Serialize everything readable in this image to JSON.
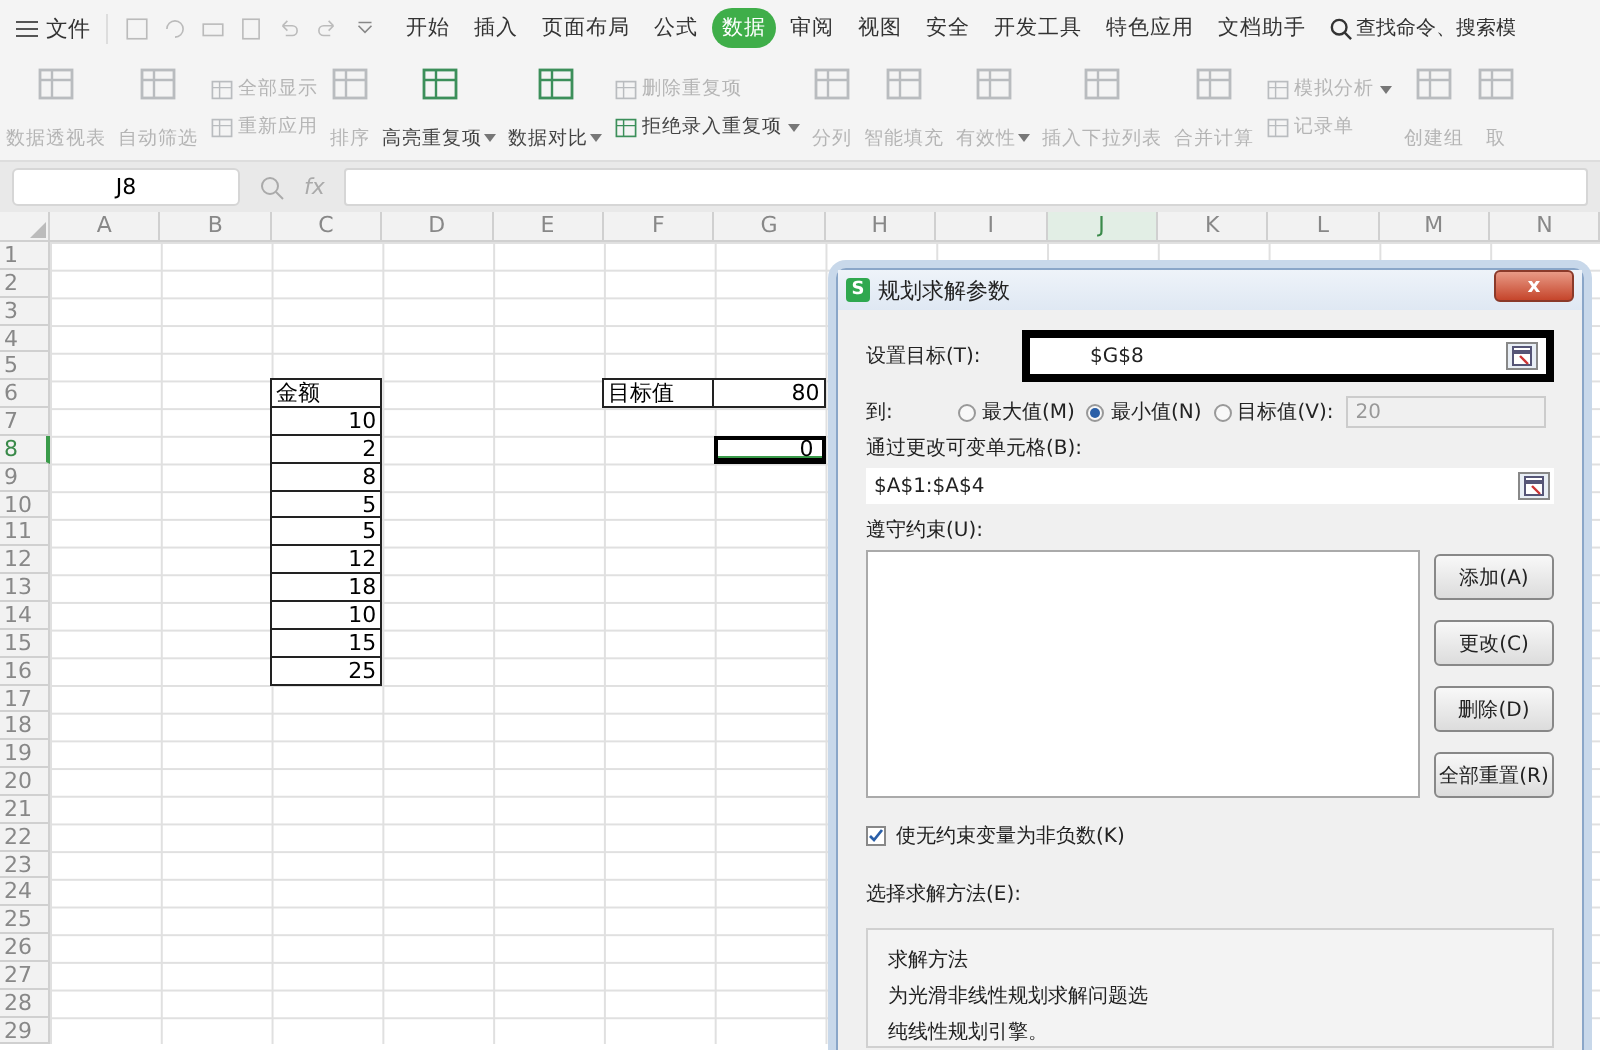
{
  "menu_bar": {
    "file": "文件",
    "tabs": [
      {
        "label": "开始",
        "selected": false
      },
      {
        "label": "插入",
        "selected": false
      },
      {
        "label": "页面布局",
        "selected": false
      },
      {
        "label": "公式",
        "selected": false
      },
      {
        "label": "数据",
        "selected": true
      },
      {
        "label": "审阅",
        "selected": false
      },
      {
        "label": "视图",
        "selected": false
      },
      {
        "label": "安全",
        "selected": false
      },
      {
        "label": "开发工具",
        "selected": false
      },
      {
        "label": "特色应用",
        "selected": false
      },
      {
        "label": "文档助手",
        "selected": false
      }
    ],
    "search": {
      "placeholder": "查找命令、搜索模"
    }
  },
  "ribbon": [
    {
      "kind": "large",
      "label": "数据透视表",
      "disabled": true,
      "dropdown": false
    },
    {
      "kind": "large",
      "label": "自动筛选",
      "disabled": true,
      "dropdown": false
    },
    {
      "kind": "stack",
      "items": [
        {
          "label": "全部显示",
          "disabled": true,
          "dropdown": false
        },
        {
          "label": "重新应用",
          "disabled": true,
          "dropdown": false
        }
      ]
    },
    {
      "kind": "large",
      "label": "排序",
      "disabled": true,
      "dropdown": false
    },
    {
      "kind": "large",
      "label": "高亮重复项",
      "disabled": false,
      "dropdown": true
    },
    {
      "kind": "large",
      "label": "数据对比",
      "disabled": false,
      "dropdown": true
    },
    {
      "kind": "stack",
      "items": [
        {
          "label": "删除重复项",
          "disabled": true,
          "dropdown": false
        },
        {
          "label": "拒绝录入重复项",
          "disabled": false,
          "dropdown": true
        }
      ]
    },
    {
      "kind": "large",
      "label": "分列",
      "disabled": true,
      "dropdown": false
    },
    {
      "kind": "large",
      "label": "智能填充",
      "disabled": true,
      "dropdown": false
    },
    {
      "kind": "large",
      "label": "有效性",
      "disabled": true,
      "dropdown": true
    },
    {
      "kind": "large",
      "label": "插入下拉列表",
      "disabled": true,
      "dropdown": false
    },
    {
      "kind": "large",
      "label": "合并计算",
      "disabled": true,
      "dropdown": false
    },
    {
      "kind": "stack",
      "items": [
        {
          "label": "模拟分析",
          "disabled": true,
          "dropdown": true
        },
        {
          "label": "记录单",
          "disabled": true,
          "dropdown": false
        }
      ]
    },
    {
      "kind": "large",
      "label": "创建组",
      "disabled": true,
      "dropdown": false
    },
    {
      "kind": "large",
      "label": "取",
      "disabled": true,
      "dropdown": false
    }
  ],
  "formula_bar": {
    "name_box": "J8",
    "fx": "fx"
  },
  "sheet": {
    "columns": [
      {
        "label": "A",
        "selected": false
      },
      {
        "label": "B",
        "selected": false
      },
      {
        "label": "C",
        "selected": false
      },
      {
        "label": "D",
        "selected": false
      },
      {
        "label": "E",
        "selected": false
      },
      {
        "label": "F",
        "selected": false
      },
      {
        "label": "G",
        "selected": false
      },
      {
        "label": "H",
        "selected": false
      },
      {
        "label": "I",
        "selected": false
      },
      {
        "label": "J",
        "selected": true
      },
      {
        "label": "K",
        "selected": false
      },
      {
        "label": "L",
        "selected": false
      },
      {
        "label": "M",
        "selected": false
      },
      {
        "label": "N",
        "selected": false
      }
    ],
    "rows": [
      {
        "label": "1",
        "selected": false
      },
      {
        "label": "2",
        "selected": false
      },
      {
        "label": "3",
        "selected": false
      },
      {
        "label": "4",
        "selected": false
      },
      {
        "label": "5",
        "selected": false
      },
      {
        "label": "6",
        "selected": false,
        "cells": [
          null,
          null,
          {
            "kind": "text",
            "text": "金额",
            "boxed": true
          },
          null,
          null,
          {
            "kind": "text",
            "text": "目标值",
            "boxed": true
          },
          {
            "kind": "number",
            "text": "80",
            "boxed": true
          }
        ]
      },
      {
        "label": "7",
        "selected": false,
        "cells": [
          null,
          null,
          {
            "kind": "number",
            "text": "10",
            "boxed": true
          }
        ]
      },
      {
        "label": "8",
        "selected": true,
        "cells": [
          null,
          null,
          {
            "kind": "number",
            "text": "2",
            "boxed": true
          },
          null,
          null,
          null,
          {
            "kind": "number",
            "text": "0",
            "marked": true
          }
        ]
      },
      {
        "label": "9",
        "selected": false,
        "cells": [
          null,
          null,
          {
            "kind": "number",
            "text": "8",
            "boxed": true
          }
        ]
      },
      {
        "label": "10",
        "selected": false,
        "cells": [
          null,
          null,
          {
            "kind": "number",
            "text": "5",
            "boxed": true
          }
        ]
      },
      {
        "label": "11",
        "selected": false,
        "cells": [
          null,
          null,
          {
            "kind": "number",
            "text": "5",
            "boxed": true
          }
        ]
      },
      {
        "label": "12",
        "selected": false,
        "cells": [
          null,
          null,
          {
            "kind": "number",
            "text": "12",
            "boxed": true
          }
        ]
      },
      {
        "label": "13",
        "selected": false,
        "cells": [
          null,
          null,
          {
            "kind": "number",
            "text": "18",
            "boxed": true
          }
        ]
      },
      {
        "label": "14",
        "selected": false,
        "cells": [
          null,
          null,
          {
            "kind": "number",
            "text": "10",
            "boxed": true
          }
        ]
      },
      {
        "label": "15",
        "selected": false,
        "cells": [
          null,
          null,
          {
            "kind": "number",
            "text": "15",
            "boxed": true
          }
        ]
      },
      {
        "label": "16",
        "selected": false,
        "cells": [
          null,
          null,
          {
            "kind": "number",
            "text": "25",
            "boxed": true
          }
        ]
      },
      {
        "label": "17",
        "selected": false
      },
      {
        "label": "18",
        "selected": false
      },
      {
        "label": "19",
        "selected": false
      },
      {
        "label": "20",
        "selected": false
      },
      {
        "label": "21",
        "selected": false
      },
      {
        "label": "22",
        "selected": false
      },
      {
        "label": "23",
        "selected": false
      },
      {
        "label": "24",
        "selected": false
      },
      {
        "label": "25",
        "selected": false
      },
      {
        "label": "26",
        "selected": false
      },
      {
        "label": "27",
        "selected": false
      },
      {
        "label": "28",
        "selected": false
      },
      {
        "label": "29",
        "selected": false
      }
    ]
  },
  "dialog": {
    "title": "规划求解参数",
    "app_icon": "S",
    "close": "x",
    "objective": {
      "label": "设置目标(T):",
      "value": "$G$8",
      "highlighted": true
    },
    "to": {
      "label": "到:",
      "options": [
        {
          "label": "最大值(M)",
          "selected": false
        },
        {
          "label": "最小值(N)",
          "selected": true
        },
        {
          "label": "目标值(V):",
          "selected": false
        }
      ],
      "value_field": {
        "value": "20",
        "disabled": true
      }
    },
    "variables": {
      "label": "通过更改可变单元格(B):",
      "value": "$A$1:$A$4"
    },
    "constraints": {
      "label": "遵守约束(U):",
      "buttons": [
        "添加(A)",
        "更改(C)",
        "删除(D)",
        "全部重置(R)"
      ]
    },
    "nonnegative": {
      "label": "使无约束变量为非负数(K)",
      "checked": true
    },
    "method_label": "选择求解方法(E):",
    "method_group": {
      "title": "求解方法",
      "lines": [
        "为光滑非线性规划求解问题选",
        "纯线性规划引擎。"
      ]
    }
  }
}
